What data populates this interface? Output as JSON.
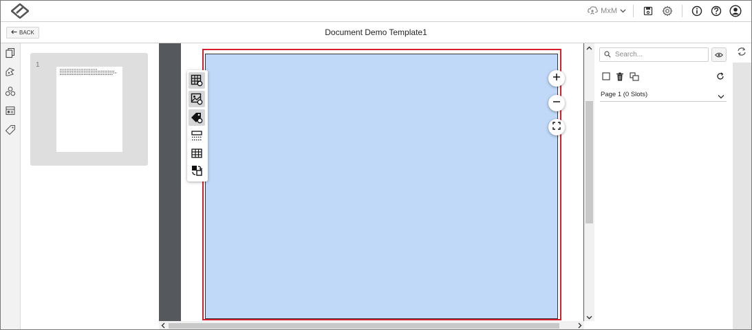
{
  "header": {
    "logo_icon": "logo-icon",
    "user_name": "MxM",
    "icons": [
      "cloud-user-icon",
      "chevron-down-icon",
      "save-icon",
      "gear-icon",
      "info-icon",
      "help-icon",
      "user-avatar-icon"
    ]
  },
  "subbar": {
    "back_label": "BACK",
    "title": "Document Demo Template1"
  },
  "left_rail": {
    "icons": [
      "pages-icon",
      "assets-icon",
      "components-icon",
      "layout-icon",
      "tags-icon"
    ]
  },
  "thumbnails": {
    "items": [
      {
        "page_number": "1"
      }
    ]
  },
  "canvas": {
    "tools": [
      "table-settings-icon",
      "image-settings-icon",
      "tag-settings-icon",
      "lines-icon",
      "grid-table-icon",
      "swap-icon"
    ],
    "active_tools": [
      0,
      1,
      2
    ],
    "zoom_controls": [
      "zoom-in-icon",
      "zoom-out-icon",
      "fit-screen-icon"
    ],
    "colors": {
      "slot_fill": "#c1d9f8",
      "selection_border": "#d71f2b",
      "canvas_background": "#55585d"
    }
  },
  "right_panel": {
    "search_placeholder": "Search...",
    "search_value": "",
    "page_row_label": "Page 1 (0 Slots)",
    "toolbar_icons": [
      "select-all-checkbox-icon",
      "trash-icon",
      "copy-icon",
      "refresh-icon"
    ]
  }
}
